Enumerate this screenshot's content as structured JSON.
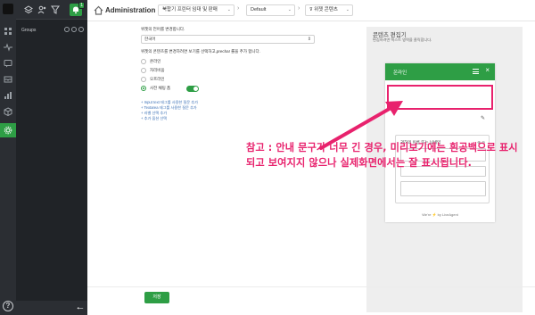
{
  "header": {
    "title": "Administration",
    "crumbs": [
      "북합기 프린터 임대 및 판매",
      "Default",
      "위젯 콘텐츠"
    ]
  },
  "sidebar": {
    "groups_label": "Groups",
    "notification_count": "1"
  },
  "form": {
    "language_label": "위젯의 언어를 변경합니다.",
    "language_value": "한국어",
    "content_label": "위젯의 콘텐츠를 변경하려면 보기를 선택하고,precha! 롤을 추가 합니다.",
    "options": [
      {
        "label": "온라인",
        "selected": false
      },
      {
        "label": "자리비움",
        "selected": false
      },
      {
        "label": "오프라인",
        "selected": false
      },
      {
        "label": "사전 채팅 폼",
        "selected": true
      }
    ],
    "prechat_toggle": true,
    "links": [
      "+ Input text 태그를 사용한 질문 추가",
      "+ Textarea 태그를 사용한 질문 추가",
      "+ 라벨 선택 추가",
      "+ 추가 옵션 선택"
    ],
    "save_label": "저장"
  },
  "preview": {
    "title": "콘텐츠 편집기",
    "subtitle": "편집하려면 텍스트 영역을 클릭합니다.",
    "widget_title": "온라인",
    "card_title": "귀하의 이름 또는 닉네임",
    "card_icons": "⊕ ⊖",
    "footer": "We're ⚡ by LiveAgent"
  },
  "annotation": {
    "text": "참고 : 안내 문구가 너무 긴 경우, 미리보기에는 흰공백으로 표시되고 보여지지 않으나 실제화면에서는 잘 표시됩니다.",
    "color": "#e8226d"
  },
  "colors": {
    "accent": "#2e9e45",
    "rail": "#2b2e33",
    "panel": "#202327"
  }
}
